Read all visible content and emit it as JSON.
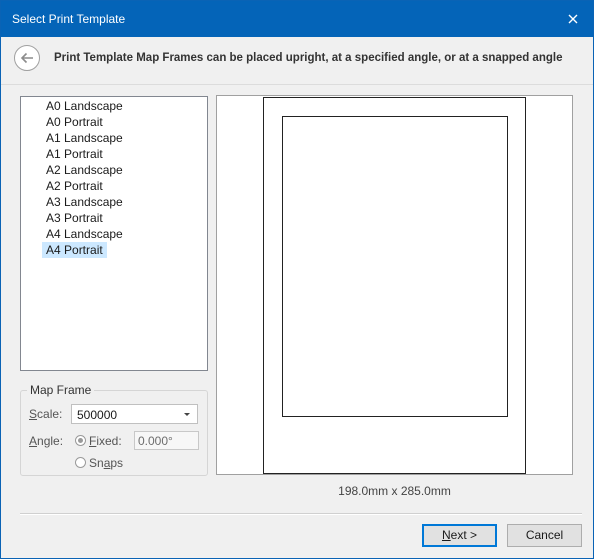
{
  "window": {
    "title": "Select Print Template",
    "close_icon": "close-icon"
  },
  "header": {
    "back_icon": "back-arrow-icon",
    "instruction": "Print Template Map Frames can be placed upright, at a specified angle, or at a snapped angle"
  },
  "templates": {
    "items": [
      {
        "label": "A0 Landscape",
        "selected": false
      },
      {
        "label": "A0 Portrait",
        "selected": false
      },
      {
        "label": "A1 Landscape",
        "selected": false
      },
      {
        "label": "A1 Portrait",
        "selected": false
      },
      {
        "label": "A2 Landscape",
        "selected": false
      },
      {
        "label": "A2 Portrait",
        "selected": false
      },
      {
        "label": "A3 Landscape",
        "selected": false
      },
      {
        "label": "A3 Portrait",
        "selected": false
      },
      {
        "label": "A4 Landscape",
        "selected": false
      },
      {
        "label": "A4 Portrait",
        "selected": true
      }
    ]
  },
  "map_frame": {
    "group_label": "Map Frame",
    "scale_label_accel": "S",
    "scale_label_rest": "cale:",
    "scale_value": "500000",
    "angle_label_accel": "A",
    "angle_label_rest": "ngle:",
    "fixed_label_accel": "F",
    "fixed_label_rest": "ixed:",
    "fixed_checked": true,
    "angle_value": "0.000°",
    "snaps_label_pre": "Sn",
    "snaps_label_accel": "a",
    "snaps_label_rest": "ps",
    "snaps_checked": false
  },
  "preview": {
    "dimensions": "198.0mm x 285.0mm"
  },
  "footer": {
    "next_accel": "N",
    "next_rest": "ext >",
    "cancel_label": "Cancel"
  },
  "colors": {
    "titlebar": "#0464b8",
    "selection": "#cce8ff",
    "default_button_border": "#0078d7"
  }
}
